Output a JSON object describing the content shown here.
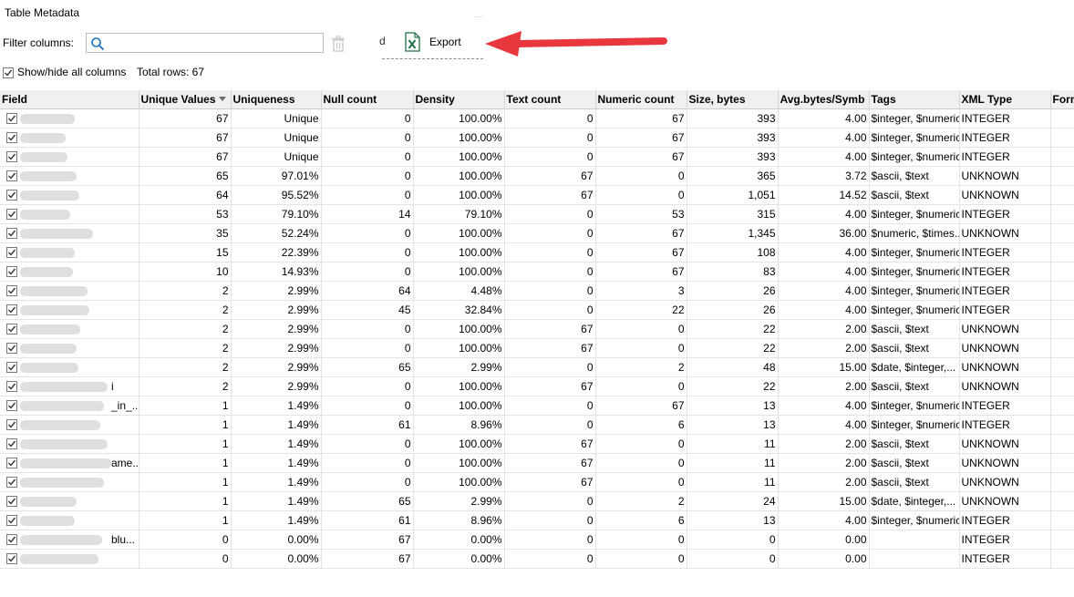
{
  "window": {
    "title": "Table Metadata"
  },
  "filter": {
    "label": "Filter columns:",
    "value": "",
    "placeholder": ""
  },
  "toolbar": {
    "truncated_label": "d",
    "export_label": "Export"
  },
  "show_all": {
    "label": "Show/hide all columns",
    "checked": true,
    "total_rows": "Total rows: 67"
  },
  "grid": {
    "columns": [
      "Field",
      "Unique Values",
      "Uniqueness",
      "Null count",
      "Density",
      "Text count",
      "Numeric count",
      "Size, bytes",
      "Avg.bytes/Symb",
      "Tags",
      "XML Type",
      "Form"
    ],
    "sort_column": "Unique Values",
    "rows": [
      {
        "field_tail": "",
        "unique": "67",
        "uniq": "Unique",
        "nulls": "0",
        "density": "100.00%",
        "text": "0",
        "numeric": "67",
        "size": "393",
        "avg": "4.00",
        "tags": "$integer, $numeric",
        "xml": "INTEGER"
      },
      {
        "field_tail": "",
        "unique": "67",
        "uniq": "Unique",
        "nulls": "0",
        "density": "100.00%",
        "text": "0",
        "numeric": "67",
        "size": "393",
        "avg": "4.00",
        "tags": "$integer, $numeric",
        "xml": "INTEGER"
      },
      {
        "field_tail": "",
        "unique": "67",
        "uniq": "Unique",
        "nulls": "0",
        "density": "100.00%",
        "text": "0",
        "numeric": "67",
        "size": "393",
        "avg": "4.00",
        "tags": "$integer, $numeric",
        "xml": "INTEGER"
      },
      {
        "field_tail": "",
        "unique": "65",
        "uniq": "97.01%",
        "nulls": "0",
        "density": "100.00%",
        "text": "67",
        "numeric": "0",
        "size": "365",
        "avg": "3.72",
        "tags": "$ascii, $text",
        "xml": "UNKNOWN"
      },
      {
        "field_tail": "",
        "unique": "64",
        "uniq": "95.52%",
        "nulls": "0",
        "density": "100.00%",
        "text": "67",
        "numeric": "0",
        "size": "1,051",
        "avg": "14.52",
        "tags": "$ascii, $text",
        "xml": "UNKNOWN"
      },
      {
        "field_tail": "",
        "unique": "53",
        "uniq": "79.10%",
        "nulls": "14",
        "density": "79.10%",
        "text": "0",
        "numeric": "53",
        "size": "315",
        "avg": "4.00",
        "tags": "$integer, $numeric",
        "xml": "INTEGER"
      },
      {
        "field_tail": "",
        "unique": "35",
        "uniq": "52.24%",
        "nulls": "0",
        "density": "100.00%",
        "text": "0",
        "numeric": "67",
        "size": "1,345",
        "avg": "36.00",
        "tags": "$numeric, $times...",
        "xml": "UNKNOWN"
      },
      {
        "field_tail": "",
        "unique": "15",
        "uniq": "22.39%",
        "nulls": "0",
        "density": "100.00%",
        "text": "0",
        "numeric": "67",
        "size": "108",
        "avg": "4.00",
        "tags": "$integer, $numeric",
        "xml": "INTEGER"
      },
      {
        "field_tail": "",
        "unique": "10",
        "uniq": "14.93%",
        "nulls": "0",
        "density": "100.00%",
        "text": "0",
        "numeric": "67",
        "size": "83",
        "avg": "4.00",
        "tags": "$integer, $numeric",
        "xml": "INTEGER"
      },
      {
        "field_tail": "",
        "unique": "2",
        "uniq": "2.99%",
        "nulls": "64",
        "density": "4.48%",
        "text": "0",
        "numeric": "3",
        "size": "26",
        "avg": "4.00",
        "tags": "$integer, $numeric",
        "xml": "INTEGER"
      },
      {
        "field_tail": "",
        "unique": "2",
        "uniq": "2.99%",
        "nulls": "45",
        "density": "32.84%",
        "text": "0",
        "numeric": "22",
        "size": "26",
        "avg": "4.00",
        "tags": "$integer, $numeric",
        "xml": "INTEGER"
      },
      {
        "field_tail": "",
        "unique": "2",
        "uniq": "2.99%",
        "nulls": "0",
        "density": "100.00%",
        "text": "67",
        "numeric": "0",
        "size": "22",
        "avg": "2.00",
        "tags": "$ascii, $text",
        "xml": "UNKNOWN"
      },
      {
        "field_tail": "",
        "unique": "2",
        "uniq": "2.99%",
        "nulls": "0",
        "density": "100.00%",
        "text": "67",
        "numeric": "0",
        "size": "22",
        "avg": "2.00",
        "tags": "$ascii, $text",
        "xml": "UNKNOWN"
      },
      {
        "field_tail": "",
        "unique": "2",
        "uniq": "2.99%",
        "nulls": "65",
        "density": "2.99%",
        "text": "0",
        "numeric": "2",
        "size": "48",
        "avg": "15.00",
        "tags": "$date, $integer,...",
        "xml": "UNKNOWN"
      },
      {
        "field_tail": "i",
        "unique": "2",
        "uniq": "2.99%",
        "nulls": "0",
        "density": "100.00%",
        "text": "67",
        "numeric": "0",
        "size": "22",
        "avg": "2.00",
        "tags": "$ascii, $text",
        "xml": "UNKNOWN"
      },
      {
        "field_tail": "_in_...",
        "unique": "1",
        "uniq": "1.49%",
        "nulls": "0",
        "density": "100.00%",
        "text": "0",
        "numeric": "67",
        "size": "13",
        "avg": "4.00",
        "tags": "$integer, $numeric",
        "xml": "INTEGER"
      },
      {
        "field_tail": "",
        "unique": "1",
        "uniq": "1.49%",
        "nulls": "61",
        "density": "8.96%",
        "text": "0",
        "numeric": "6",
        "size": "13",
        "avg": "4.00",
        "tags": "$integer, $numeric",
        "xml": "INTEGER"
      },
      {
        "field_tail": "",
        "unique": "1",
        "uniq": "1.49%",
        "nulls": "0",
        "density": "100.00%",
        "text": "67",
        "numeric": "0",
        "size": "11",
        "avg": "2.00",
        "tags": "$ascii, $text",
        "xml": "UNKNOWN"
      },
      {
        "field_tail": "ame...",
        "unique": "1",
        "uniq": "1.49%",
        "nulls": "0",
        "density": "100.00%",
        "text": "67",
        "numeric": "0",
        "size": "11",
        "avg": "2.00",
        "tags": "$ascii, $text",
        "xml": "UNKNOWN"
      },
      {
        "field_tail": "",
        "unique": "1",
        "uniq": "1.49%",
        "nulls": "0",
        "density": "100.00%",
        "text": "67",
        "numeric": "0",
        "size": "11",
        "avg": "2.00",
        "tags": "$ascii, $text",
        "xml": "UNKNOWN"
      },
      {
        "field_tail": "",
        "unique": "1",
        "uniq": "1.49%",
        "nulls": "65",
        "density": "2.99%",
        "text": "0",
        "numeric": "2",
        "size": "24",
        "avg": "15.00",
        "tags": "$date, $integer,...",
        "xml": "UNKNOWN"
      },
      {
        "field_tail": "",
        "unique": "1",
        "uniq": "1.49%",
        "nulls": "61",
        "density": "8.96%",
        "text": "0",
        "numeric": "6",
        "size": "13",
        "avg": "4.00",
        "tags": "$integer, $numeric",
        "xml": "INTEGER"
      },
      {
        "field_tail": "blu...",
        "unique": "0",
        "uniq": "0.00%",
        "nulls": "67",
        "density": "0.00%",
        "text": "0",
        "numeric": "0",
        "size": "0",
        "avg": "0.00",
        "tags": "",
        "xml": "INTEGER"
      },
      {
        "field_tail": "",
        "unique": "0",
        "uniq": "0.00%",
        "nulls": "67",
        "density": "0.00%",
        "text": "0",
        "numeric": "0",
        "size": "0",
        "avg": "0.00",
        "tags": "",
        "xml": "INTEGER"
      }
    ]
  },
  "colors": {
    "arrow": "#e8383d",
    "excel_green": "#1e7145",
    "search_blue": "#1a73c8"
  }
}
